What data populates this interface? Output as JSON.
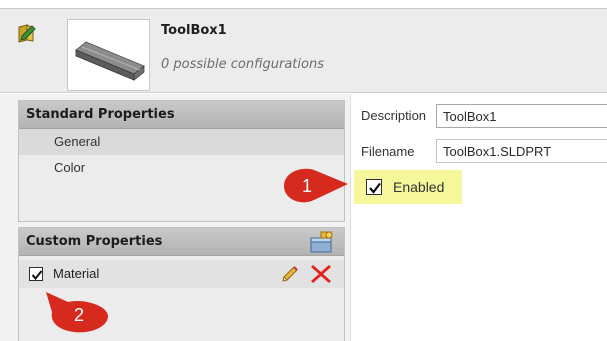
{
  "part": {
    "title": "ToolBox1",
    "subtitle": "0 possible configurations",
    "header_icon": "edit-part-icon",
    "thumbnail": "steel-angle-bar-thumbnail"
  },
  "standard_properties": {
    "title": "Standard Properties",
    "items": [
      {
        "label": "General",
        "selected": true
      },
      {
        "label": "Color",
        "selected": false
      }
    ]
  },
  "custom_properties": {
    "title": "Custom Properties",
    "add_icon": "add-property-icon",
    "items": [
      {
        "label": "Material",
        "checked": true,
        "edit_icon": "pencil-icon",
        "delete_icon": "delete-x-icon"
      }
    ]
  },
  "fields": {
    "description_label": "Description",
    "description_value": "ToolBox1",
    "filename_label": "Filename",
    "filename_value": "ToolBox1.SLDPRT",
    "enabled_label": "Enabled",
    "enabled_checked": true
  },
  "callouts": [
    "1",
    "2"
  ],
  "colors": {
    "callout_red": "#d62a1f",
    "highlight_yellow": "#f6f79b",
    "delete_red": "#e0231c"
  }
}
